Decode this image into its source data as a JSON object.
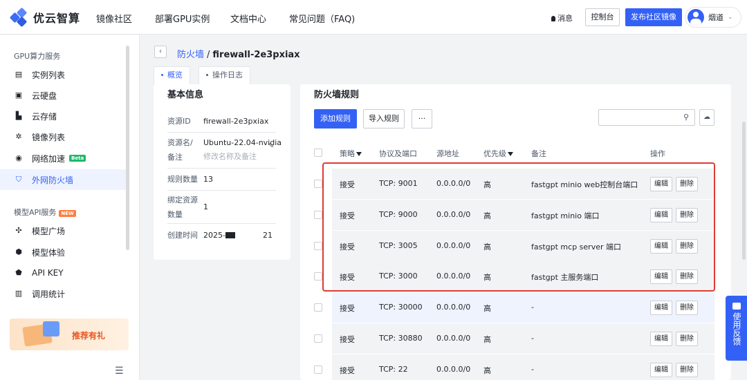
{
  "header": {
    "logo_text": "优云智算",
    "nav": [
      "镜像社区",
      "部署GPU实例",
      "文档中心",
      "常见问题（FAQ)"
    ],
    "messages_label": "消息",
    "console_label": "控制台",
    "publish_label": "发布社区镜像",
    "user_name": "烟道"
  },
  "sidebar": {
    "group1_title": "GPU算力服务",
    "group1_items": [
      {
        "label": "实例列表",
        "icon": "instance-list-icon"
      },
      {
        "label": "云硬盘",
        "icon": "cloud-disk-icon"
      },
      {
        "label": "云存储",
        "icon": "cloud-storage-icon"
      },
      {
        "label": "镜像列表",
        "icon": "image-list-icon"
      },
      {
        "label": "网络加速",
        "icon": "network-accel-icon",
        "badge": "Beta"
      },
      {
        "label": "外网防火墙",
        "icon": "firewall-icon",
        "active": true
      }
    ],
    "group2_title": "模型API服务",
    "group2_badge": "NEW",
    "group2_items": [
      {
        "label": "模型广场",
        "icon": "model-square-icon"
      },
      {
        "label": "模型体验",
        "icon": "model-trial-icon"
      },
      {
        "label": "API KEY",
        "icon": "api-key-icon"
      },
      {
        "label": "调用统计",
        "icon": "usage-stats-icon"
      }
    ],
    "promo_text": "推荐有礼"
  },
  "breadcrumb": {
    "parent": "防火墙",
    "separator": "/",
    "current": "firewall-2e3pxiax"
  },
  "tabs": [
    "概览",
    "操作日志"
  ],
  "info": {
    "title": "基本信息",
    "rows": [
      {
        "label": "资源ID",
        "value": "firewall-2e3pxiax"
      },
      {
        "label": "资源名/备注",
        "value": "Ubuntu-22.04-nvidia",
        "sub": "修改名称及备注"
      },
      {
        "label": "规则数量",
        "value": "13"
      },
      {
        "label": "绑定资源数量",
        "value": "1"
      },
      {
        "label": "创建时间",
        "value_prefix": "2025-",
        "value_suffix": "21"
      }
    ]
  },
  "rules": {
    "title": "防火墙规则",
    "add_button": "添加规则",
    "import_button": "导入规则",
    "more_button": "···",
    "search_placeholder": "",
    "columns": [
      "策略",
      "协议及端口",
      "源地址",
      "优先级",
      "备注",
      "操作"
    ],
    "edit_label": "编辑",
    "delete_label": "删除",
    "rows": [
      {
        "policy": "接受",
        "port": "TCP: 9001",
        "source": "0.0.0.0/0",
        "priority": "高",
        "note": "fastgpt minio web控制台端口"
      },
      {
        "policy": "接受",
        "port": "TCP: 9000",
        "source": "0.0.0.0/0",
        "priority": "高",
        "note": "fastgpt minio 端口"
      },
      {
        "policy": "接受",
        "port": "TCP: 3005",
        "source": "0.0.0.0/0",
        "priority": "高",
        "note": "fastgpt mcp server 端口"
      },
      {
        "policy": "接受",
        "port": "TCP: 3000",
        "source": "0.0.0.0/0",
        "priority": "高",
        "note": "fastgpt 主服务端口"
      },
      {
        "policy": "接受",
        "port": "TCP: 30000",
        "source": "0.0.0.0/0",
        "priority": "高",
        "note": "-"
      },
      {
        "policy": "接受",
        "port": "TCP: 30880",
        "source": "0.0.0.0/0",
        "priority": "高",
        "note": "-"
      },
      {
        "policy": "接受",
        "port": "TCP: 22",
        "source": "0.0.0.0/0",
        "priority": "高",
        "note": "-"
      }
    ]
  },
  "feedback_label": "使用反馈",
  "colors": {
    "accent": "#3461f5",
    "highlight_frame": "#e03a32",
    "beta": "#1fb86b",
    "new": "#ff7d3f"
  }
}
